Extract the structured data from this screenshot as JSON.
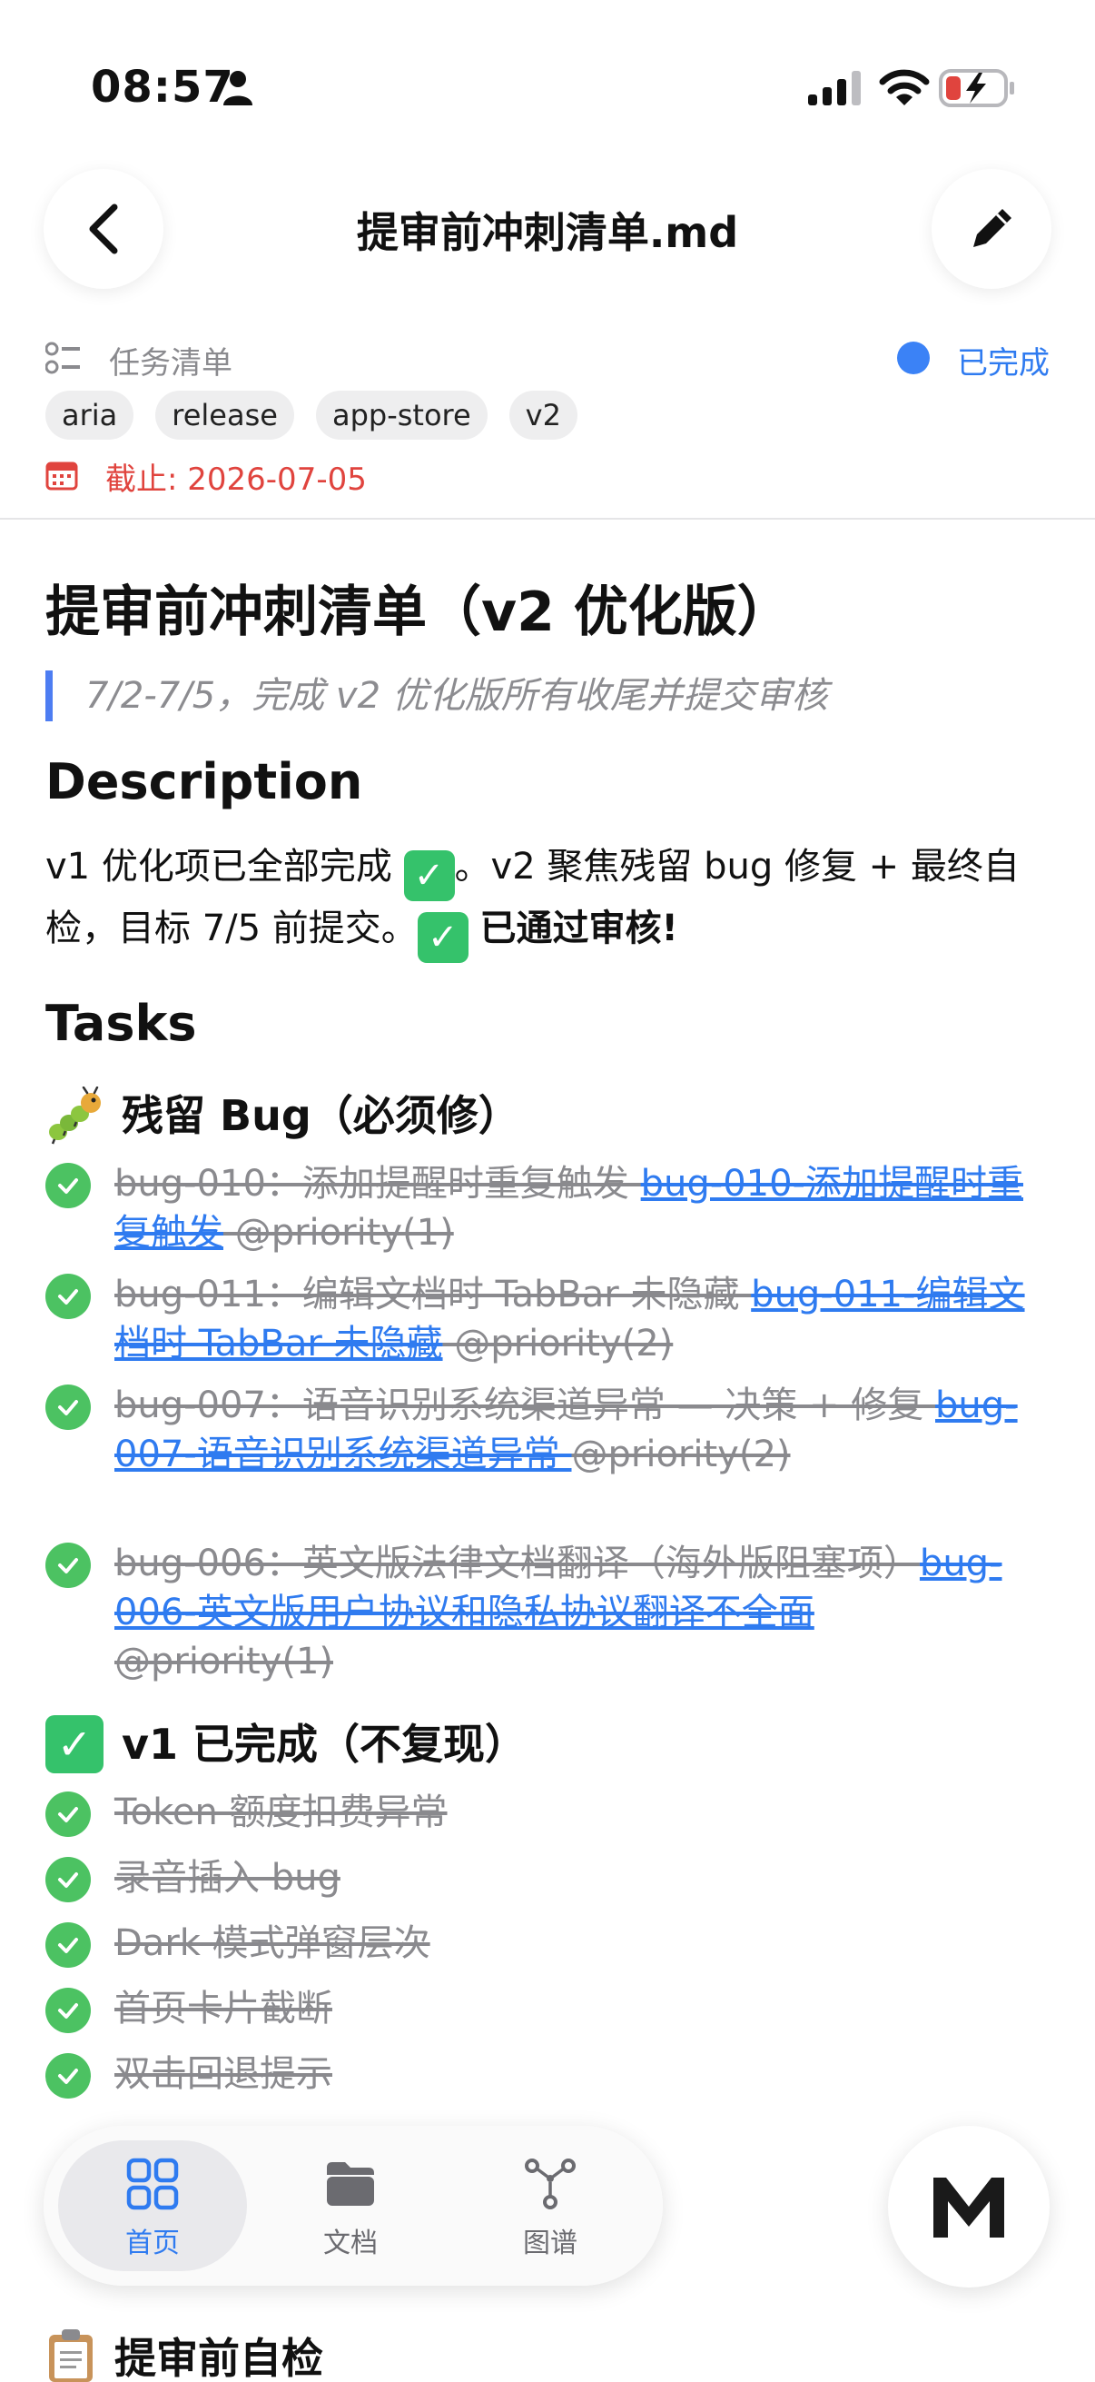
{
  "status_bar": {
    "time": "08:57"
  },
  "nav": {
    "title": "提审前冲刺清单.md"
  },
  "meta": {
    "type_label": "任务清单",
    "status": "已完成",
    "tags": [
      "aria",
      "release",
      "app-store",
      "v2"
    ],
    "deadline": "截止: 2026-07-05"
  },
  "doc": {
    "title": "提审前冲刺清单（v2 优化版）",
    "quote": "7/2-7/5，完成 v2 优化版所有收尾并提交审核",
    "description_heading": "Description",
    "desc_part1": "v1 优化项已全部完成 ",
    "desc_part2": "。v2 聚焦残留 bug 修复 + 最终自检，目标 7/5 前提交。",
    "desc_bold": "已通过审核!",
    "tasks_heading": "Tasks",
    "section1_heading": "残留 Bug（必须修）",
    "bug_tasks": [
      {
        "text": "bug-010：添加提醒时重复触发 ",
        "link": "bug-010-添加提醒时重复触发",
        "tail": " @priority(1)"
      },
      {
        "text": "bug-011：编辑文档时 TabBar 未隐藏 ",
        "link": "bug-011-编辑文档时 TabBar 未隐藏",
        "tail": " @priority(2)"
      },
      {
        "text": "bug-007：语音识别系统渠道异常 — 决策 + 修复 ",
        "link": "bug-007-语音识别系统渠道异常 ",
        "tail": "@priority(2)"
      },
      {
        "text": "bug-006：英文版法律文档翻译（海外版阻塞项）",
        "link": "bug-006-英文版用户协议和隐私协议翻译不全面",
        "tail": "@priority(1)"
      }
    ],
    "section2_heading": "v1 已完成（不复现）",
    "done_tasks": [
      "Token 额度扣费异常",
      "录音插入 bug",
      "Dark 模式弹窗层次",
      "首页卡片截断",
      "双击回退提示"
    ],
    "section3_heading": "提审前自检"
  },
  "tabbar": {
    "tabs": [
      {
        "label": "首页"
      },
      {
        "label": "文档"
      },
      {
        "label": "图谱"
      }
    ]
  },
  "colors": {
    "accent": "#2f7bf0",
    "done_green": "#4cc262",
    "deadline_red": "#e0443e",
    "quote_bar": "#4d7df2"
  }
}
